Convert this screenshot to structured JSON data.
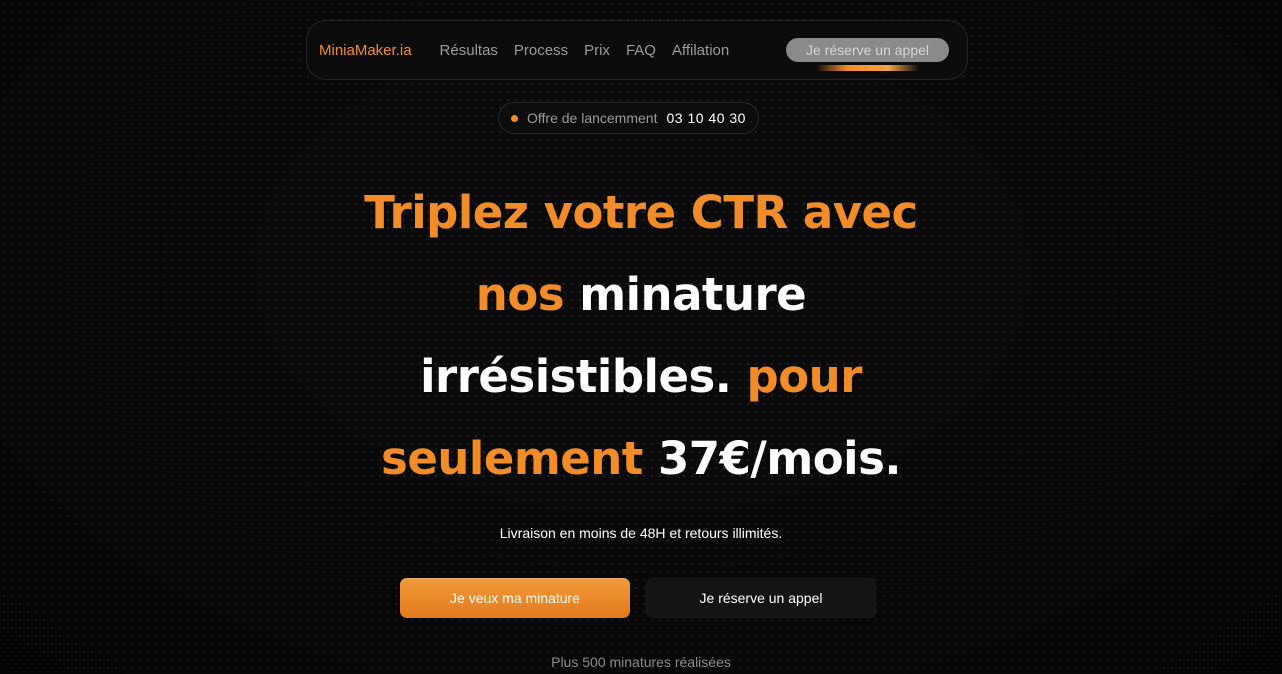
{
  "nav": {
    "logo": "MiniaMaker.ia",
    "links": [
      "Résultas",
      "Process",
      "Prix",
      "FAQ",
      "Affilation"
    ],
    "cta_label": "Je réserve un appel"
  },
  "offer": {
    "label": "Offre de lancemment",
    "timer": "03 10 40 30"
  },
  "hero": {
    "headline": {
      "line1": "Triplez votre CTR avec",
      "line2_orange": "nos",
      "line2_white": "minature",
      "line3_white": "irrésistibles.",
      "line3_orange": "pour",
      "line4_orange": "seulement",
      "line4_white": "37€/mois."
    },
    "subtitle": "Livraison en moins de 48H et retours illimités.",
    "primary_cta": "Je veux ma minature",
    "secondary_cta": "Je réserve un appel",
    "social_proof": "Plus 500 minatures réalisées"
  },
  "colors": {
    "accent": "#f28c28",
    "background": "#0a0a0a",
    "text": "#ffffff",
    "muted": "#9a9a9a"
  }
}
